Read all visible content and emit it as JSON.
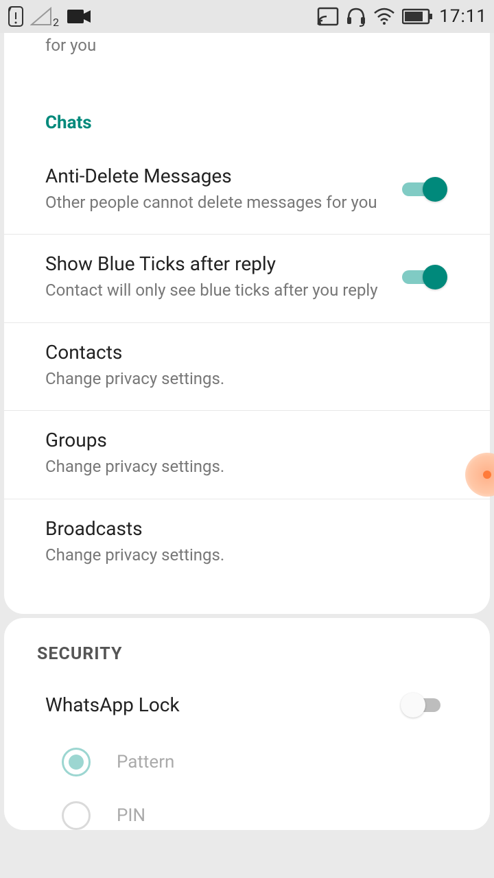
{
  "status": {
    "time": "17:11",
    "sim_badge": "2"
  },
  "cutoff_text": "for you",
  "chats": {
    "header": "Chats",
    "anti_delete": {
      "title": "Anti-Delete Messages",
      "subtitle": "Other people cannot delete messages for you",
      "on": true
    },
    "blue_ticks": {
      "title": "Show Blue Ticks after reply",
      "subtitle": "Contact will only see blue ticks after you reply",
      "on": true
    },
    "contacts": {
      "title": "Contacts",
      "subtitle": "Change privacy settings."
    },
    "groups": {
      "title": "Groups",
      "subtitle": "Change privacy settings."
    },
    "broadcasts": {
      "title": "Broadcasts",
      "subtitle": "Change privacy settings."
    }
  },
  "security": {
    "header": "SECURITY",
    "lock": {
      "title": "WhatsApp Lock",
      "on": false
    },
    "option_pattern": "Pattern",
    "option_pin": "PIN"
  }
}
